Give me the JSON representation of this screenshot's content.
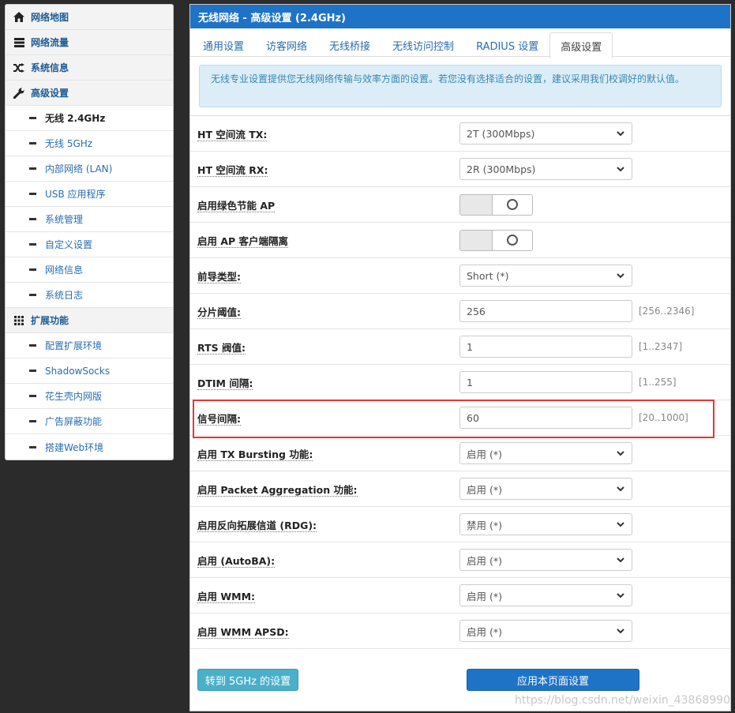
{
  "sidebar": {
    "items": [
      {
        "type": "top",
        "icon": "home-icon",
        "label": "网络地图"
      },
      {
        "type": "top",
        "icon": "list-icon",
        "label": "网络流量"
      },
      {
        "type": "top",
        "icon": "shuffle-icon",
        "label": "系统信息"
      },
      {
        "type": "top",
        "icon": "wrench-icon",
        "label": "高级设置"
      },
      {
        "type": "sub",
        "label": "无线 2.4GHz",
        "active": true
      },
      {
        "type": "sub",
        "label": "无线 5GHz"
      },
      {
        "type": "sub",
        "label": "内部网络 (LAN)"
      },
      {
        "type": "sub",
        "label": "USB 应用程序"
      },
      {
        "type": "sub",
        "label": "系统管理"
      },
      {
        "type": "sub",
        "label": "自定义设置"
      },
      {
        "type": "sub",
        "label": "网络信息"
      },
      {
        "type": "sub",
        "label": "系统日志"
      },
      {
        "type": "top",
        "icon": "grid-icon",
        "label": "扩展功能"
      },
      {
        "type": "sub",
        "label": "配置扩展环境"
      },
      {
        "type": "sub",
        "label": "ShadowSocks"
      },
      {
        "type": "sub",
        "label": "花生壳内网版"
      },
      {
        "type": "sub",
        "label": "广告屏蔽功能"
      },
      {
        "type": "sub",
        "label": "搭建Web环境"
      }
    ]
  },
  "panel": {
    "title": "无线网络 - 高级设置 (2.4GHz)",
    "tabs": [
      "通用设置",
      "访客网络",
      "无线桥接",
      "无线访问控制",
      "RADIUS 设置",
      "高级设置"
    ],
    "active_tab": 5,
    "alert": "无线专业设置提供您无线网络传输与效率方面的设置。若您没有选择适合的设置，建议采用我们校调好的默认值。"
  },
  "rows": [
    {
      "label": "HT 空间流 TX:",
      "kind": "select",
      "value": "2T (300Mbps)"
    },
    {
      "label": "HT 空间流 RX:",
      "kind": "select",
      "value": "2R (300Mbps)"
    },
    {
      "label": "启用绿色节能 AP",
      "kind": "toggle",
      "value": "off"
    },
    {
      "label": "启用 AP 客户端隔离",
      "kind": "toggle",
      "value": "off"
    },
    {
      "label": "前导类型:",
      "kind": "select",
      "value": "Short (*)"
    },
    {
      "label": "分片阈值:",
      "kind": "input",
      "value": "256",
      "hint": "[256..2346]"
    },
    {
      "label": "RTS 阀值:",
      "kind": "input",
      "value": "1",
      "hint": "[1..2347]"
    },
    {
      "label": "DTIM 间隔:",
      "kind": "input",
      "value": "1",
      "hint": "[1..255]"
    },
    {
      "label": "信号间隔:",
      "kind": "input",
      "value": "60",
      "hint": "[20..1000]"
    },
    {
      "label": "启用 TX Bursting 功能:",
      "kind": "select",
      "value": "启用 (*)"
    },
    {
      "label": "启用 Packet Aggregation 功能:",
      "kind": "select",
      "value": "启用 (*)"
    },
    {
      "label": "启用反向拓展信道 (RDG):",
      "kind": "select",
      "value": "禁用 (*)"
    },
    {
      "label": "启用 (AutoBA):",
      "kind": "select",
      "value": "启用 (*)"
    },
    {
      "label": "启用 WMM:",
      "kind": "select",
      "value": "启用 (*)"
    },
    {
      "label": "启用 WMM APSD:",
      "kind": "select",
      "value": "启用 (*)"
    }
  ],
  "buttons": {
    "goto_5g": "转到 5GHz 的设置",
    "apply": "应用本页面设置"
  },
  "watermark": "https://blog.csdn.net/weixin_43868990",
  "colors": {
    "header_blue": "#1e73c7",
    "highlight_red": "#e0383a",
    "alert_bg": "#dcedf7",
    "info_button": "#4ab0c9"
  }
}
